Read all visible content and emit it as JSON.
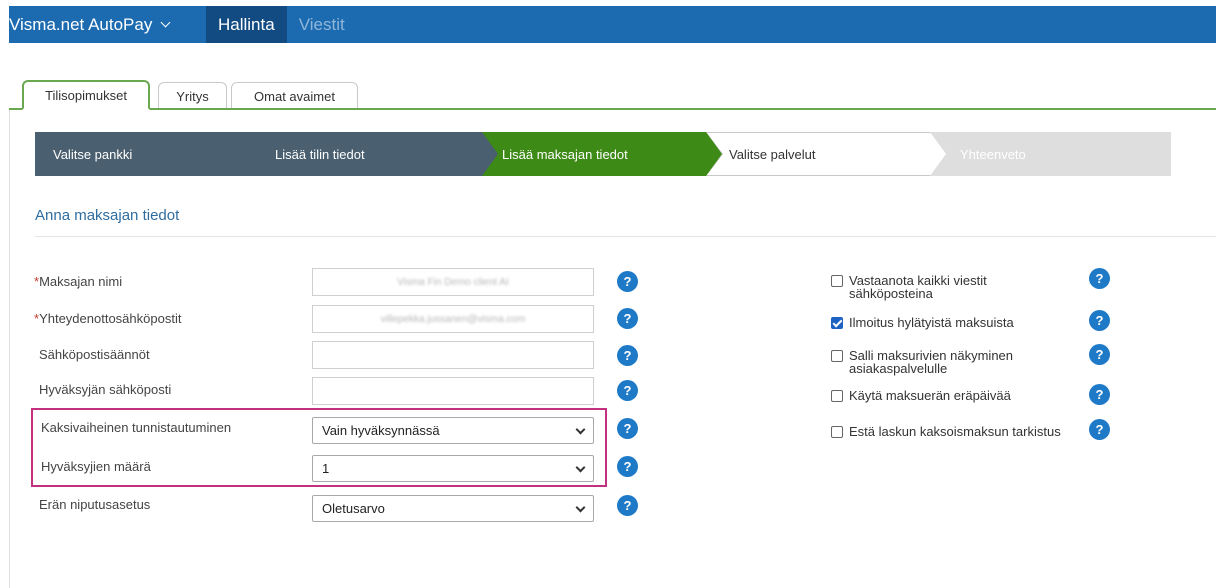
{
  "topbar": {
    "app_title": "Visma.net AutoPay",
    "nav": [
      {
        "label": "Hallinta",
        "active": true
      },
      {
        "label": "Viestit",
        "active": false
      }
    ],
    "accent": "#1c6bb0"
  },
  "tabs": [
    {
      "label": "Tilisopimukset",
      "active": true
    },
    {
      "label": "Yritys",
      "active": false
    },
    {
      "label": "Omat avaimet",
      "active": false
    }
  ],
  "wizard": {
    "steps": [
      {
        "label": "Valitse pankki",
        "state": "done"
      },
      {
        "label": "Lisää tilin tiedot",
        "state": "done"
      },
      {
        "label": "Lisää maksajan tiedot",
        "state": "current"
      },
      {
        "label": "Valitse palvelut",
        "state": "next"
      },
      {
        "label": "Yhteenveto",
        "state": "future"
      }
    ],
    "colors": {
      "done": "#4a5f6f",
      "current": "#3d8a16",
      "future": "#dedede"
    }
  },
  "section_title": "Anna maksajan tiedot",
  "form": {
    "payer_name": {
      "label": "Maksajan nimi",
      "required": true,
      "value": "Visma Fin Demo client AI"
    },
    "contact_emails": {
      "label": "Yhteydenottosähköpostit",
      "required": true,
      "value": "villepekka.jussanen@visma.com"
    },
    "email_rules": {
      "label": "Sähköpostisäännöt",
      "value": ""
    },
    "approver_email": {
      "label": "Hyväksyjän sähköposti",
      "value": ""
    },
    "two_factor": {
      "label": "Kaksivaiheinen tunnistautuminen",
      "selected": "Vain hyväksynnässä"
    },
    "approver_count": {
      "label": "Hyväksyjien määrä",
      "selected": "1"
    },
    "batch_setting": {
      "label": "Erän niputusasetus",
      "selected": "Oletusarvo"
    },
    "help_glyph": "?"
  },
  "options": [
    {
      "label": "Vastaanota kaikki viestit sähköposteina",
      "checked": false
    },
    {
      "label": "Ilmoitus hylätyistä maksuista",
      "checked": true
    },
    {
      "label": "Salli maksurivien näkyminen asiakaspalvelulle",
      "checked": false
    },
    {
      "label": "Käytä maksuerän eräpäivää",
      "checked": false
    },
    {
      "label": "Estä laskun kaksoismaksun tarkistus",
      "checked": false
    }
  ],
  "highlight_color": "#c2307e"
}
